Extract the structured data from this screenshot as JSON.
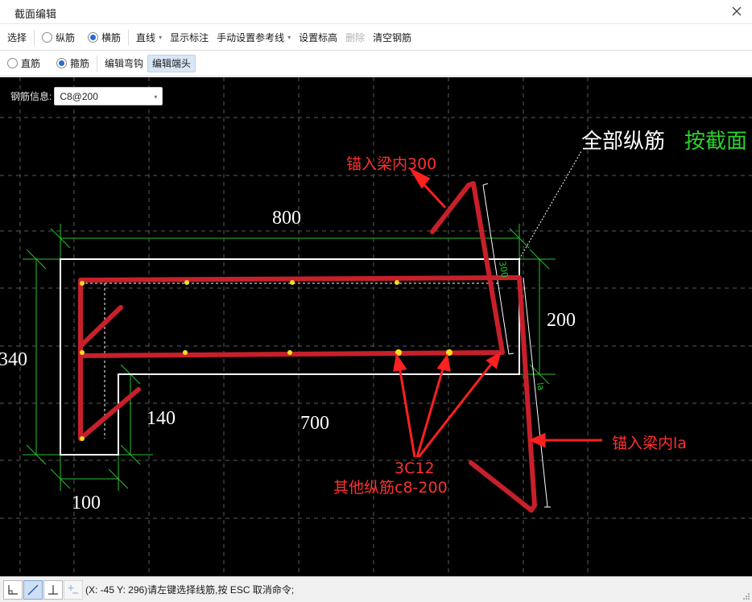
{
  "window": {
    "title": "截面编辑"
  },
  "toolbar1": {
    "select": "选择",
    "radio_longitudinal": "纵筋",
    "radio_transverse": "横筋",
    "line_dropdown": "直线",
    "show_annotation": "显示标注",
    "manual_reference": "手动设置参考线",
    "set_elevation": "设置标高",
    "delete": "删除",
    "clear_rebar": "清空钢筋"
  },
  "toolbar2": {
    "radio_straight": "直筋",
    "radio_stirrup": "箍筋",
    "edit_hook": "编辑弯钩",
    "edit_end": "编辑端头"
  },
  "rebar_info": {
    "label": "钢筋信息:",
    "value": "C8@200"
  },
  "drawing": {
    "dims": {
      "d800": "800",
      "d340": "340",
      "d200": "200",
      "d140": "140",
      "d700": "700",
      "d100": "100",
      "d300_small": "300",
      "la_small": "la"
    },
    "callout_top_white": "全部纵筋",
    "callout_top_green": "按截面",
    "annot_anchor_300": "锚入梁内300",
    "annot_anchor_la": "锚入梁内la",
    "annot_3c12": "3C12",
    "annot_other": "其他纵筋c8-200",
    "colors": {
      "background": "#000000",
      "outline": "#ffffff",
      "dimension": "#22c32a",
      "rebar": "#c8202a",
      "annotation": "#ff3030",
      "point": "#f5e020",
      "grid": "#5a5a5a"
    }
  },
  "statusbar": {
    "message": "(X: -45 Y: 296)请左键选择线筋,按 ESC 取消命令;"
  }
}
